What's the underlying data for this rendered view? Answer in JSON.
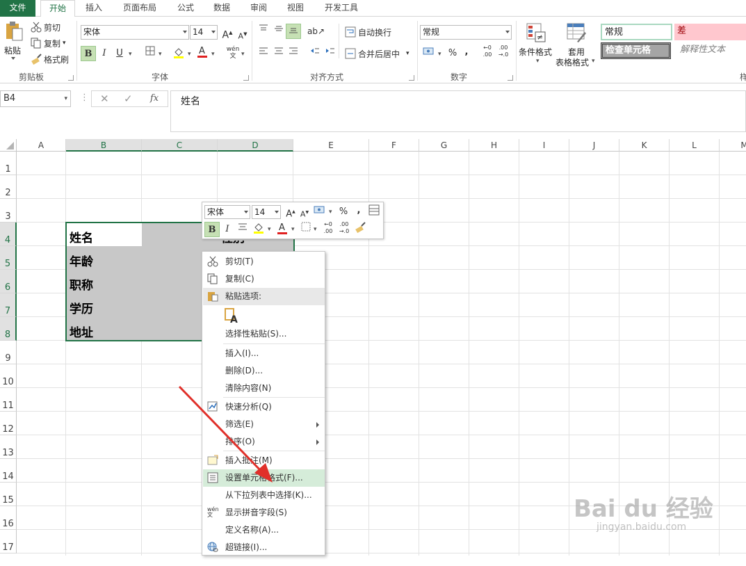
{
  "tabs": {
    "file": "文件",
    "home": "开始",
    "insert": "插入",
    "layout": "页面布局",
    "formulas": "公式",
    "data": "数据",
    "review": "审阅",
    "view": "视图",
    "developer": "开发工具"
  },
  "clipboard": {
    "paste": "粘贴",
    "cut": "剪切",
    "copy": "复制",
    "format_painter": "格式刷",
    "label": "剪贴板"
  },
  "font": {
    "name": "宋体",
    "size": "14",
    "label": "字体",
    "bold": "B",
    "italic": "I",
    "underline": "U"
  },
  "alignment": {
    "wrap": "自动换行",
    "merge": "合并后居中",
    "label": "对齐方式"
  },
  "number": {
    "format": "常规",
    "label": "数字",
    "percent": "%",
    "comma": ","
  },
  "styles": {
    "conditional": "条件格式",
    "table_fmt_1": "套用",
    "table_fmt_2": "表格格式",
    "normal": "常规",
    "bad": "差",
    "check": "检查单元格",
    "explanatory": "解释性文本",
    "label_partial": "样"
  },
  "formula_bar": {
    "name_box": "B4",
    "formula": "姓名",
    "fx": "fx"
  },
  "columns": [
    "A",
    "B",
    "C",
    "D",
    "E",
    "F",
    "G",
    "H",
    "I",
    "J",
    "K",
    "L",
    "M"
  ],
  "rows": [
    "1",
    "2",
    "3",
    "4",
    "5",
    "6",
    "7",
    "8",
    "9",
    "10",
    "11",
    "12",
    "13",
    "14",
    "15",
    "16",
    "17"
  ],
  "cells": {
    "b4": "姓名",
    "b5": "年龄",
    "b6": "职称",
    "b7": "学历",
    "b8": "地址",
    "d4": "性别"
  },
  "mini": {
    "font": "宋体",
    "size": "14",
    "bold": "B",
    "italic": "I",
    "percent": "%",
    "comma": ","
  },
  "menu": {
    "cut": "剪切(T)",
    "copy": "复制(C)",
    "paste_options": "粘贴选项:",
    "paste_special": "选择性粘贴(S)...",
    "insert": "插入(I)...",
    "delete": "删除(D)...",
    "clear": "清除内容(N)",
    "quick_analysis": "快速分析(Q)",
    "filter": "筛选(E)",
    "sort": "排序(O)",
    "insert_comment": "插入批注(M)",
    "format_cells": "设置单元格格式(F)...",
    "pick_list": "从下拉列表中选择(K)...",
    "phonetic": "显示拼音字段(S)",
    "define_name": "定义名称(A)...",
    "hyperlink": "超链接(I)..."
  },
  "watermark": {
    "brand": "Bai du 经验",
    "url": "jingyan.baidu.com"
  },
  "colors": {
    "excel_green": "#217346",
    "selection": "#c8c8c8",
    "highlight": "#d5ecd9",
    "arrow": "#e0302a"
  }
}
